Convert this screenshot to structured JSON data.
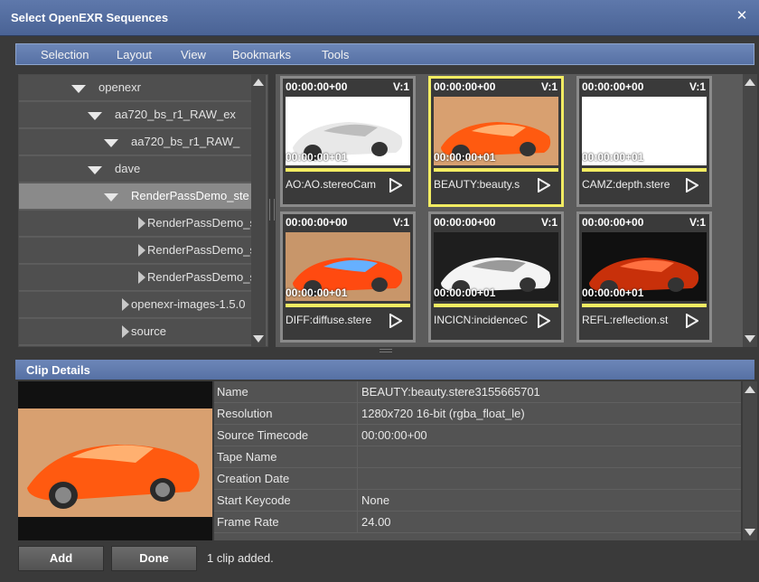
{
  "window": {
    "title": "Select OpenEXR Sequences",
    "close_glyph": "✕"
  },
  "menu": [
    "Selection",
    "Layout",
    "View",
    "Bookmarks",
    "Tools"
  ],
  "tree": [
    {
      "label": "openexr",
      "indent": 0,
      "expanded": true,
      "selected": false
    },
    {
      "label": "aa720_bs_r1_RAW_ex",
      "indent": 1,
      "expanded": true,
      "selected": false
    },
    {
      "label": "aa720_bs_r1_RAW_",
      "indent": 2,
      "expanded": true,
      "selected": false
    },
    {
      "label": "dave",
      "indent": 1,
      "expanded": true,
      "selected": false
    },
    {
      "label": "RenderPassDemo_ste",
      "indent": 2,
      "expanded": true,
      "selected": true
    },
    {
      "label": "RenderPassDemo_ste",
      "indent": 3,
      "expanded": false,
      "selected": false
    },
    {
      "label": "RenderPassDemo_ste",
      "indent": 3,
      "expanded": false,
      "selected": false
    },
    {
      "label": "RenderPassDemo_ste",
      "indent": 3,
      "expanded": false,
      "selected": false
    },
    {
      "label": "openexr-images-1.5.0",
      "indent": 2,
      "expanded": false,
      "selected": false
    },
    {
      "label": "source",
      "indent": 2,
      "expanded": false,
      "selected": false
    }
  ],
  "clips": [
    {
      "tc_start": "00:00:00+00",
      "version": "V:1",
      "tc_end": "00:00:00+01",
      "name": "AO:AO.stereoCam",
      "thumb": "ao",
      "selected": false
    },
    {
      "tc_start": "00:00:00+00",
      "version": "V:1",
      "tc_end": "00:00:00+01",
      "name": "BEAUTY:beauty.s",
      "thumb": "beauty",
      "selected": true
    },
    {
      "tc_start": "00:00:00+00",
      "version": "V:1",
      "tc_end": "00:00:00+01",
      "name": "CAMZ:depth.stere",
      "thumb": "depth",
      "selected": false
    },
    {
      "tc_start": "00:00:00+00",
      "version": "V:1",
      "tc_end": "00:00:00+01",
      "name": "DIFF:diffuse.stere",
      "thumb": "diffuse",
      "selected": false
    },
    {
      "tc_start": "00:00:00+00",
      "version": "V:1",
      "tc_end": "00:00:00+01",
      "name": "INCICN:incidenceC",
      "thumb": "incidence",
      "selected": false
    },
    {
      "tc_start": "00:00:00+00",
      "version": "V:1",
      "tc_end": "00:00:00+01",
      "name": "REFL:reflection.st",
      "thumb": "reflection",
      "selected": false
    }
  ],
  "details": {
    "title": "Clip Details",
    "rows": [
      {
        "key": "Name",
        "value": "BEAUTY:beauty.stere3155665701"
      },
      {
        "key": "Resolution",
        "value": "1280x720 16-bit (rgba_float_le)"
      },
      {
        "key": "Source Timecode",
        "value": "00:00:00+00"
      },
      {
        "key": "Tape Name",
        "value": ""
      },
      {
        "key": "Creation Date",
        "value": ""
      },
      {
        "key": "Start Keycode",
        "value": "None"
      },
      {
        "key": "Frame Rate",
        "value": "24.00"
      }
    ]
  },
  "buttons": {
    "add": "Add",
    "done": "Done"
  },
  "status": "1 clip added.",
  "colors": {
    "title_bar": "#4a6395",
    "highlight": "#f2ec62",
    "panel": "#5b5b5b"
  }
}
